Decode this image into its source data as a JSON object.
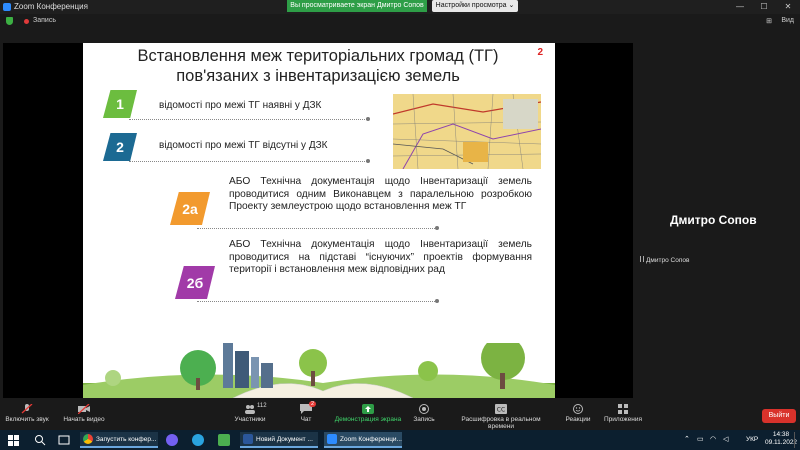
{
  "window": {
    "title": "Zoom Конференция",
    "minimize": "—",
    "maximize": "☐",
    "close": "✕"
  },
  "status": {
    "record": "Запись"
  },
  "banner": {
    "viewing": "Вы просматриваете экран Дмитро Сопов",
    "view_options": "Настройки просмотра ⌄"
  },
  "topright": {
    "icon1": "⊞",
    "icon2": "Вид"
  },
  "slide": {
    "title_line1": "Встановлення меж територіальних громад (ТГ)",
    "title_line2": "пов'язаних з інвентаризацією земель",
    "page_num": "2",
    "items": [
      {
        "badge": "1",
        "text": "відомості про межі ТГ наявні у ДЗК",
        "color": "#6cbd3f"
      },
      {
        "badge": "2",
        "text": "відомості про межі ТГ відсутні у ДЗК",
        "color": "#1c6a93"
      }
    ],
    "options": [
      {
        "badge": "2а",
        "text": "АБО Технічна документація щодо Інвентаризації земель проводитися одним Виконавцем з паралельною розробкою Проекту землеустрою щодо встановлення меж ТГ",
        "color": "#f29a2e"
      },
      {
        "badge": "2б",
        "text": "АБО Технічна документація щодо Інвентаризації земель проводитися на підставі “існуючих” проектів формування території і встановлення меж відповідних рад",
        "color": "#a13aa8"
      }
    ]
  },
  "speaker": {
    "name": "Дмитро Сопов",
    "label": "Дмитро Сопов"
  },
  "toolbar": {
    "mute": "Включить звук",
    "video": "Начать видео",
    "participants": "Участники",
    "participants_count": "112",
    "chat": "Чат",
    "chat_badge": "2",
    "share": "Демонстрация экрана",
    "record": "Запись",
    "transcript": "Расшифровка в реальном времени",
    "reactions": "Реакции",
    "apps": "Приложения",
    "exit": "Выйти"
  },
  "taskbar": {
    "chrome_task": "Запустить конфер...",
    "word_task": "Новий Документ ...",
    "zoom_task": "Zoom Конференци...",
    "lang": "УКР",
    "time": "14:38",
    "date": "09.11.2022"
  },
  "colors": {
    "accent_green": "#2e9e47",
    "exit_red": "#d9322b",
    "zoom_blue": "#2d8cff"
  }
}
